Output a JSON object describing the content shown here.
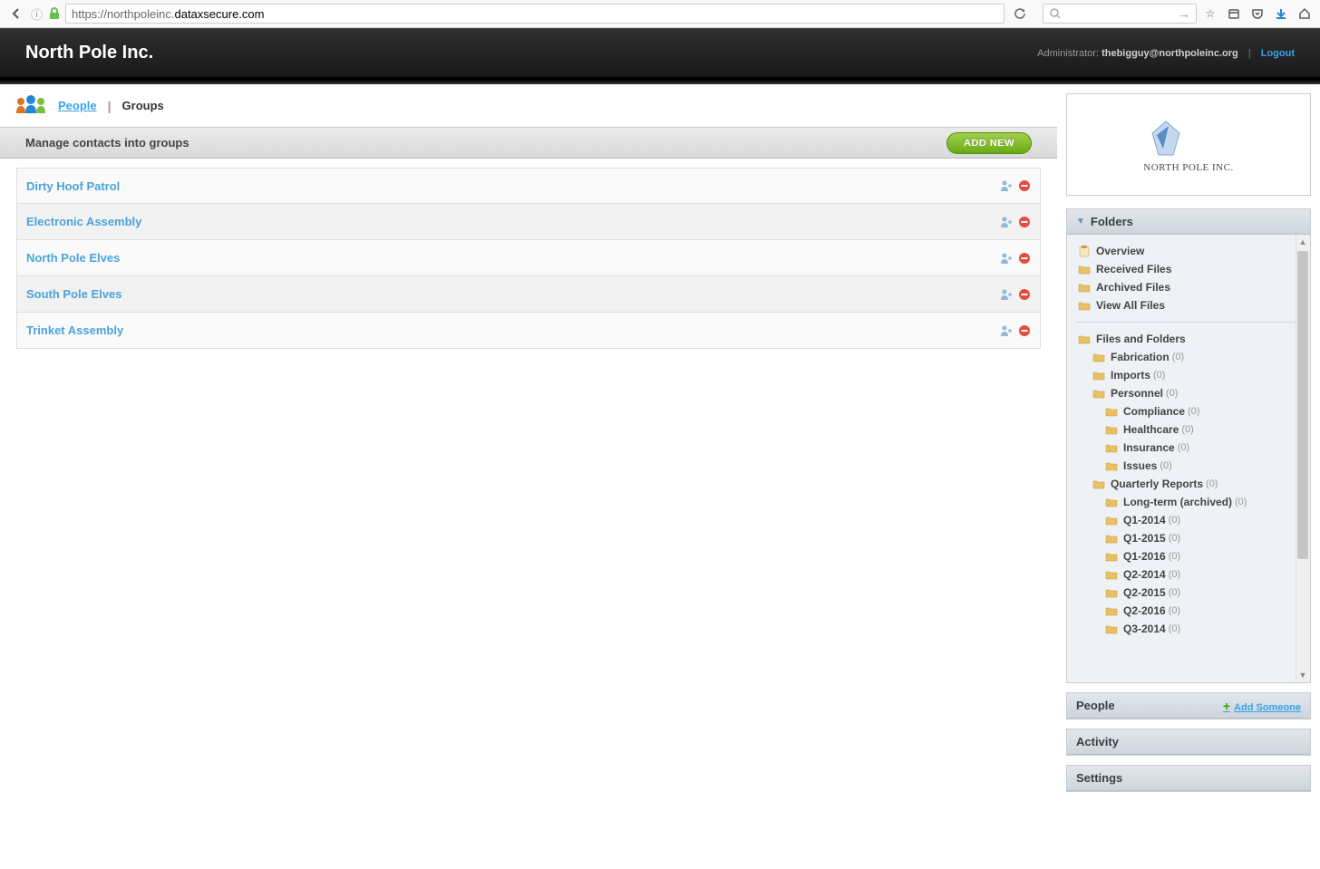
{
  "browser": {
    "url_prefix": "https://",
    "url_sub": "northpoleinc.",
    "url_domain": "dataxsecure.com"
  },
  "header": {
    "company": "North Pole Inc.",
    "admin_label": "Administrator: ",
    "admin_email": "thebigguy@northpoleinc.org",
    "logout": "Logout"
  },
  "tabs": {
    "people": "People",
    "groups": "Groups"
  },
  "section": {
    "title": "Manage contacts into groups",
    "add_new": "ADD NEW"
  },
  "groups": [
    {
      "name": "Dirty Hoof Patrol"
    },
    {
      "name": "Electronic Assembly"
    },
    {
      "name": "North Pole Elves"
    },
    {
      "name": "South Pole Elves"
    },
    {
      "name": "Trinket Assembly"
    }
  ],
  "logo": {
    "text": "NORTH POLE INC."
  },
  "sidebar": {
    "folders_title": "Folders",
    "people_title": "People",
    "add_someone": "Add Someone",
    "activity_title": "Activity",
    "settings_title": "Settings",
    "quick": [
      {
        "label": "Overview",
        "icon": "clipboard"
      },
      {
        "label": "Received Files",
        "icon": "folder"
      },
      {
        "label": "Archived Files",
        "icon": "folder"
      },
      {
        "label": "View All Files",
        "icon": "folder"
      }
    ],
    "root": "Files and Folders",
    "tree": [
      {
        "label": "Fabrication",
        "count": "(0)",
        "indent": 1
      },
      {
        "label": "Imports",
        "count": "(0)",
        "indent": 1
      },
      {
        "label": "Personnel",
        "count": "(0)",
        "indent": 1
      },
      {
        "label": "Compliance",
        "count": "(0)",
        "indent": 2
      },
      {
        "label": "Healthcare",
        "count": "(0)",
        "indent": 2
      },
      {
        "label": "Insurance",
        "count": "(0)",
        "indent": 2
      },
      {
        "label": "Issues",
        "count": "(0)",
        "indent": 2
      },
      {
        "label": "Quarterly Reports",
        "count": "(0)",
        "indent": 1
      },
      {
        "label": "Long-term (archived)",
        "count": "(0)",
        "indent": 2
      },
      {
        "label": "Q1-2014",
        "count": "(0)",
        "indent": 2
      },
      {
        "label": "Q1-2015",
        "count": "(0)",
        "indent": 2
      },
      {
        "label": "Q1-2016",
        "count": "(0)",
        "indent": 2
      },
      {
        "label": "Q2-2014",
        "count": "(0)",
        "indent": 2
      },
      {
        "label": "Q2-2015",
        "count": "(0)",
        "indent": 2
      },
      {
        "label": "Q2-2016",
        "count": "(0)",
        "indent": 2
      },
      {
        "label": "Q3-2014",
        "count": "(0)",
        "indent": 2
      }
    ]
  }
}
